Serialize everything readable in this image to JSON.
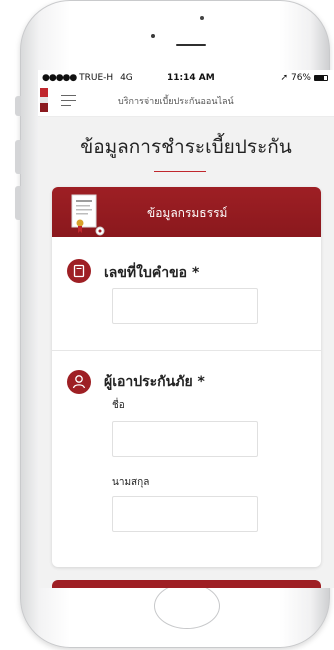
{
  "status_bar": {
    "carrier_dots": "●●●●●",
    "carrier": "TRUE-H",
    "network": "4G",
    "time": "11:14 AM",
    "location_arrow": "➚",
    "battery_percent": "76%",
    "battery_level": 0.76
  },
  "app_bar": {
    "menu_icon": "hamburger-icon",
    "title": "บริการจ่ายเบี้ยประกันออนไลน์"
  },
  "page": {
    "title": "ข้อมูลการชำระเบี้ยประกัน"
  },
  "card": {
    "header_title": "ข้อมูลกรมธรรม์",
    "header_icon": "document-certificate-icon",
    "sections": [
      {
        "icon": "book-icon",
        "title": "เลขที่ใบคำขอ *",
        "fields": [
          {
            "label": "",
            "value": "",
            "placeholder": ""
          }
        ]
      },
      {
        "icon": "user-icon",
        "title": "ผู้เอาประกันภัย *",
        "fields": [
          {
            "label": "ชื่อ",
            "value": "",
            "placeholder": ""
          },
          {
            "label": "นามสกุล",
            "value": "",
            "placeholder": ""
          }
        ]
      }
    ]
  },
  "colors": {
    "accent": "#9e1f24",
    "accent_dark": "#8a181d",
    "background": "#f2f2f2"
  }
}
